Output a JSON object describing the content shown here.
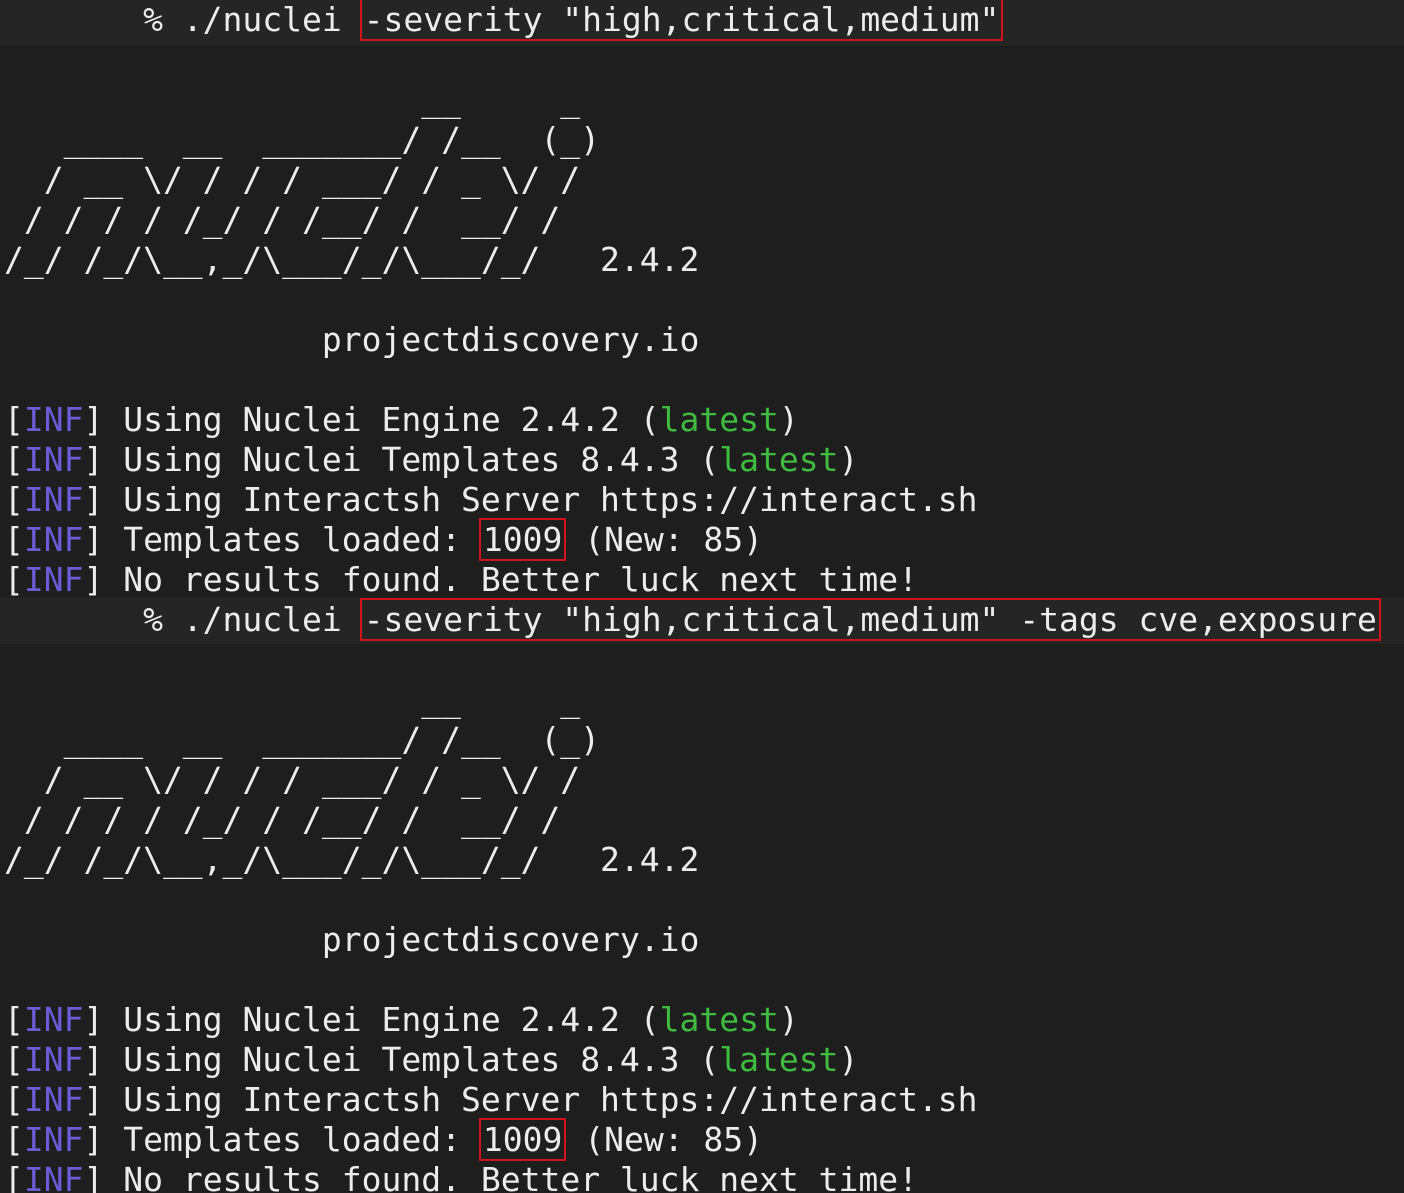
{
  "colors": {
    "background": "#1e1e1e",
    "text": "#ececec",
    "inf_tag": "#6d5bd8",
    "latest": "#3fbb3f",
    "highlight_box": "#d1141b"
  },
  "sessions": [
    {
      "command": {
        "prompt": "       % ./nuclei ",
        "args": "-severity \"high,critical,medium\""
      },
      "banner": [
        "                     __     _",
        "   ____  __  _______/ /__  (_)",
        "  / __ \\/ / / / ___/ / _ \\/ /",
        " / / / / /_/ / /__/ /  __/ /",
        "/_/ /_/\\__,_/\\___/_/\\___/_/   2.4.2"
      ],
      "site": "                projectdiscovery.io",
      "logs": {
        "engine": {
          "tag": "INF",
          "text": "Using Nuclei Engine 2.4.2 (",
          "status": "latest",
          "tail": ")"
        },
        "templates": {
          "tag": "INF",
          "text": "Using Nuclei Templates 8.4.3 (",
          "status": "latest",
          "tail": ")"
        },
        "interactsh": {
          "tag": "INF",
          "text": "Using Interactsh Server https://interact.sh"
        },
        "loaded": {
          "tag": "INF",
          "text": "Templates loaded: ",
          "count": "1009",
          "tail": "(New: 85)"
        },
        "result": {
          "tag": "INF",
          "text": "No results found. Better luck next time!"
        }
      }
    },
    {
      "command": {
        "prompt": "       % ./nuclei ",
        "args": "-severity \"high,critical,medium\" -tags cve,exposure"
      },
      "banner": [
        "                     __     _",
        "   ____  __  _______/ /__  (_)",
        "  / __ \\/ / / / ___/ / _ \\/ /",
        " / / / / /_/ / /__/ /  __/ /",
        "/_/ /_/\\__,_/\\___/_/\\___/_/   2.4.2"
      ],
      "site": "                projectdiscovery.io",
      "logs": {
        "engine": {
          "tag": "INF",
          "text": "Using Nuclei Engine 2.4.2 (",
          "status": "latest",
          "tail": ")"
        },
        "templates": {
          "tag": "INF",
          "text": "Using Nuclei Templates 8.4.3 (",
          "status": "latest",
          "tail": ")"
        },
        "interactsh": {
          "tag": "INF",
          "text": "Using Interactsh Server https://interact.sh"
        },
        "loaded": {
          "tag": "INF",
          "text": "Templates loaded: ",
          "count": "1009",
          "tail": "(New: 85)"
        },
        "result": {
          "tag": "INF",
          "text": "No results found. Better luck next time!"
        }
      }
    }
  ]
}
